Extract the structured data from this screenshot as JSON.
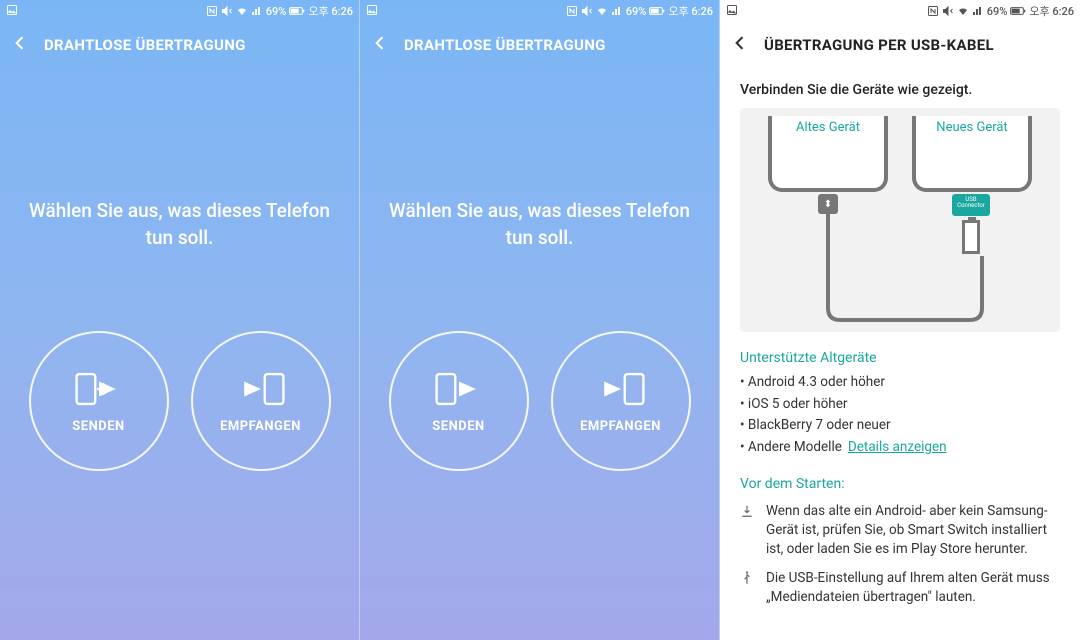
{
  "status": {
    "battery": "69%",
    "time": "오후 6:26"
  },
  "blue_screen": {
    "title": "DRAHTLOSE ÜBERTRAGUNG",
    "instruction": "Wählen Sie aus, was dieses Telefon tun soll.",
    "send_label": "SENDEN",
    "receive_label": "EMPFANGEN"
  },
  "usb_screen": {
    "title": "ÜBERTRAGUNG PER USB-KABEL",
    "instruction": "Verbinden Sie die Geräte wie gezeigt.",
    "old_device": "Altes Gerät",
    "new_device": "Neues Gerät",
    "adapter_label": "USB Connector",
    "supported_title": "Unterstützte Altgeräte",
    "supported_items": [
      "Android 4.3 oder höher",
      "iOS 5 oder höher",
      "BlackBerry 7 oder neuer",
      "Andere Modelle"
    ],
    "details_link": "Details anzeigen",
    "before_title": "Vor dem Starten:",
    "tip1": "Wenn das alte ein Android- aber kein Samsung-Gerät ist, prüfen Sie, ob Smart Switch installiert ist, oder laden Sie es im Play Store herunter.",
    "tip2": "Die USB-Einstellung auf Ihrem alten Gerät muss „Mediendateien übertragen\" lauten."
  }
}
